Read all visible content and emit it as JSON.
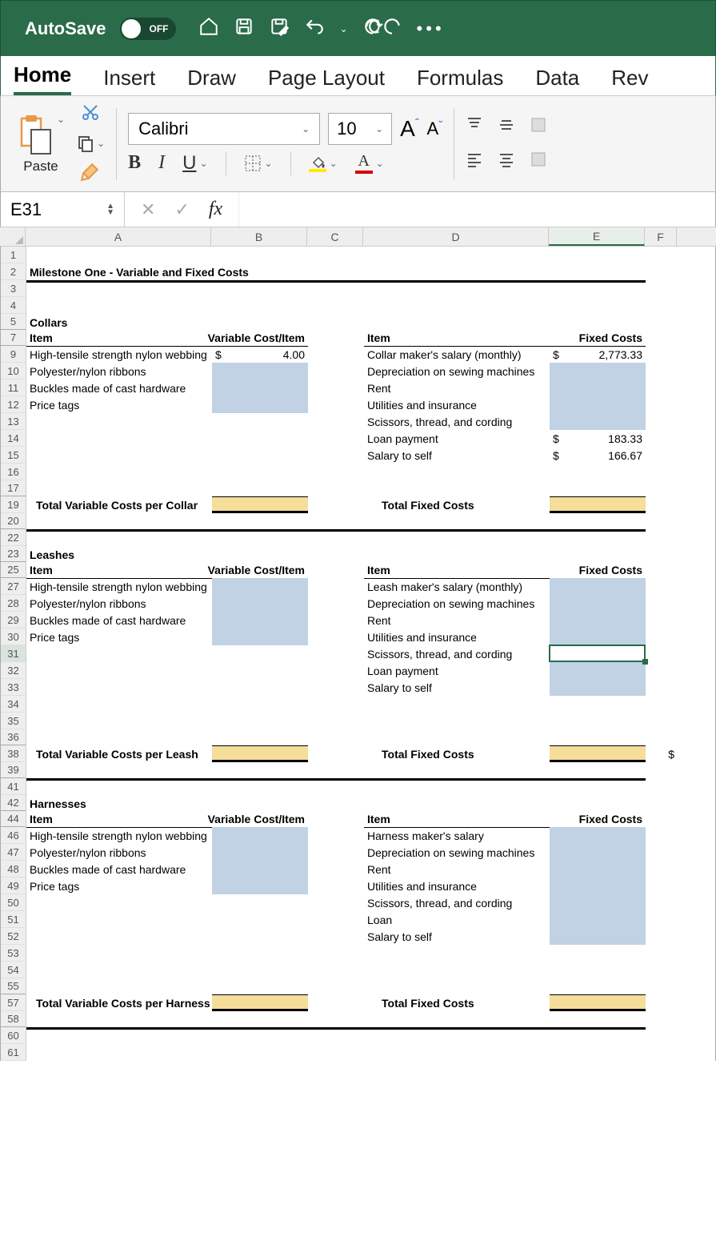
{
  "titlebar": {
    "autosave_label": "AutoSave",
    "autosave_state": "OFF"
  },
  "ribbon": {
    "tabs": [
      "Home",
      "Insert",
      "Draw",
      "Page Layout",
      "Formulas",
      "Data",
      "Rev"
    ],
    "active_tab": "Home",
    "paste_label": "Paste",
    "font_name": "Calibri",
    "font_size": "10",
    "bold": "B",
    "italic": "I",
    "underline": "U"
  },
  "formula_bar": {
    "name_box": "E31",
    "fx": "fx",
    "value": ""
  },
  "columns": [
    "A",
    "B",
    "C",
    "D",
    "E",
    "F"
  ],
  "row_numbers": [
    1,
    2,
    3,
    4,
    5,
    7,
    9,
    10,
    11,
    12,
    13,
    14,
    15,
    16,
    17,
    19,
    20,
    22,
    23,
    25,
    27,
    28,
    29,
    30,
    31,
    32,
    33,
    34,
    35,
    36,
    38,
    39,
    41,
    42,
    44,
    46,
    47,
    48,
    49,
    50,
    51,
    52,
    53,
    54,
    55,
    57,
    58,
    60,
    61
  ],
  "hidden_after": [
    5,
    7,
    17,
    20,
    23,
    25,
    36,
    39,
    42,
    44,
    55,
    58
  ],
  "sheet": {
    "title": "Milestone One - Variable and Fixed Costs",
    "sections": {
      "collars": {
        "name": "Collars",
        "hdr_item": "Item",
        "hdr_varcost": "Variable Cost/Item",
        "hdr_fixed": "Fixed Costs",
        "var_items": [
          {
            "name": "High-tensile strength nylon webbing",
            "sym": "$",
            "val": "4.00"
          },
          {
            "name": "Polyester/nylon ribbons"
          },
          {
            "name": "Buckles made of cast hardware"
          },
          {
            "name": "Price tags"
          }
        ],
        "fixed_items": [
          {
            "name": "Collar maker's salary (monthly)",
            "sym": "$",
            "val": "2,773.33"
          },
          {
            "name": "Depreciation on sewing machines"
          },
          {
            "name": "Rent"
          },
          {
            "name": "Utilities and insurance"
          },
          {
            "name": "Scissors, thread, and cording"
          },
          {
            "name": "Loan payment",
            "sym": "$",
            "val": "183.33"
          },
          {
            "name": "Salary to self",
            "sym": "$",
            "val": "166.67"
          }
        ],
        "total_var_label": "Total Variable Costs per Collar",
        "total_fixed_label": "Total Fixed Costs"
      },
      "leashes": {
        "name": "Leashes",
        "hdr_item": "Item",
        "hdr_varcost": "Variable Cost/Item",
        "hdr_fixed": "Fixed Costs",
        "var_items": [
          {
            "name": "High-tensile strength nylon webbing"
          },
          {
            "name": "Polyester/nylon ribbons"
          },
          {
            "name": "Buckles made of cast hardware"
          },
          {
            "name": "Price tags"
          }
        ],
        "fixed_items": [
          {
            "name": "Leash maker's salary (monthly)"
          },
          {
            "name": "Depreciation on sewing machines"
          },
          {
            "name": "Rent"
          },
          {
            "name": "Utilities and insurance"
          },
          {
            "name": "Scissors, thread, and cording"
          },
          {
            "name": "Loan payment"
          },
          {
            "name": "Salary to self"
          }
        ],
        "total_var_label": "Total Variable Costs per Leash",
        "total_fixed_label": "Total Fixed Costs",
        "f_sym": "$"
      },
      "harnesses": {
        "name": "Harnesses",
        "hdr_item": "Item",
        "hdr_varcost": "Variable Cost/Item",
        "hdr_fixed": "Fixed Costs",
        "var_items": [
          {
            "name": "High-tensile strength nylon webbing"
          },
          {
            "name": "Polyester/nylon ribbons"
          },
          {
            "name": "Buckles made of cast hardware"
          },
          {
            "name": "Price tags"
          }
        ],
        "fixed_items": [
          {
            "name": "Harness maker's salary"
          },
          {
            "name": "Depreciation on sewing machines"
          },
          {
            "name": "Rent"
          },
          {
            "name": "Utilities and insurance"
          },
          {
            "name": "Scissors, thread, and cording"
          },
          {
            "name": "Loan"
          },
          {
            "name": "Salary to self"
          }
        ],
        "total_var_label": "Total Variable Costs per Harness",
        "total_fixed_label": "Total Fixed Costs"
      }
    }
  },
  "selected_cell": "E31"
}
